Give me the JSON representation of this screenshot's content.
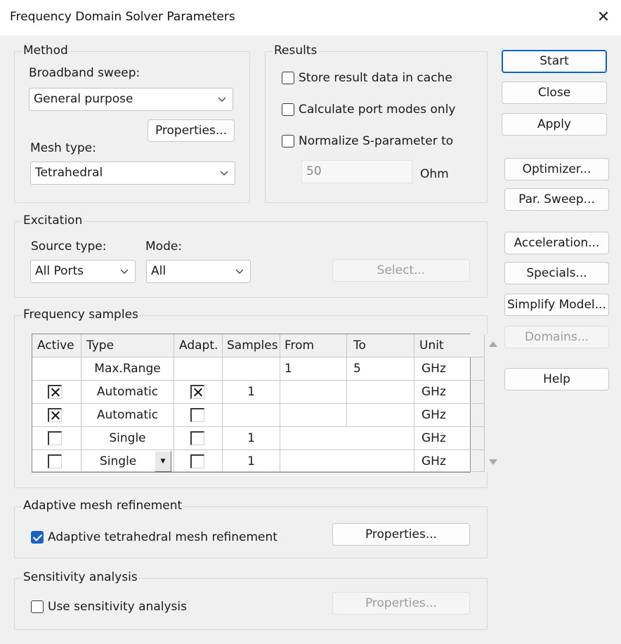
{
  "window": {
    "title": "Frequency Domain Solver Parameters"
  },
  "method": {
    "group_label": "Method",
    "broadband_label": "Broadband sweep:",
    "broadband_value": "General purpose",
    "properties_label": "Properties...",
    "mesh_label": "Mesh type:",
    "mesh_value": "Tetrahedral"
  },
  "results": {
    "group_label": "Results",
    "store_cache_label": "Store result data in cache",
    "store_cache_checked": false,
    "port_modes_label": "Calculate port modes only",
    "port_modes_checked": false,
    "normalize_label": "Normalize S-parameter to",
    "normalize_checked": false,
    "normalize_value": "50",
    "normalize_unit": "Ohm"
  },
  "excitation": {
    "group_label": "Excitation",
    "source_type_label": "Source type:",
    "source_type_value": "All Ports",
    "mode_label": "Mode:",
    "mode_value": "All",
    "select_label": "Select..."
  },
  "frequency_samples": {
    "group_label": "Frequency samples",
    "columns": [
      "Active",
      "Type",
      "Adapt.",
      "Samples",
      "From",
      "To",
      "Unit"
    ],
    "rows": [
      {
        "active": null,
        "type": "Max.Range",
        "adapt": null,
        "samples": "",
        "from": "1",
        "to": "5",
        "unit": "GHz"
      },
      {
        "active": true,
        "type": "Automatic",
        "adapt": true,
        "samples": "1",
        "from": "",
        "to": "",
        "unit": "GHz"
      },
      {
        "active": true,
        "type": "Automatic",
        "adapt": false,
        "samples": "",
        "from": "",
        "to": "",
        "unit": "GHz"
      },
      {
        "active": false,
        "type": "Single",
        "adapt": false,
        "samples": "1",
        "from": "",
        "to": "",
        "unit": "GHz"
      },
      {
        "active": false,
        "type": "Single",
        "adapt": false,
        "samples": "1",
        "from": "",
        "to": "",
        "unit": "GHz"
      }
    ]
  },
  "adaptive": {
    "group_label": "Adaptive mesh refinement",
    "checkbox_label": "Adaptive tetrahedral mesh refinement",
    "checked": true,
    "properties_label": "Properties..."
  },
  "sensitivity": {
    "group_label": "Sensitivity analysis",
    "checkbox_label": "Use sensitivity analysis",
    "checked": false,
    "properties_label": "Properties..."
  },
  "side_buttons": {
    "start": "Start",
    "close": "Close",
    "apply": "Apply",
    "optimizer": "Optimizer...",
    "par_sweep": "Par. Sweep...",
    "acceleration": "Acceleration...",
    "specials": "Specials...",
    "simplify": "Simplify Model...",
    "domains": "Domains...",
    "help": "Help"
  },
  "colors": {
    "accent": "#0a64c8",
    "checkbox_blue": "#1b62c6",
    "background": "#f0f0f0"
  }
}
